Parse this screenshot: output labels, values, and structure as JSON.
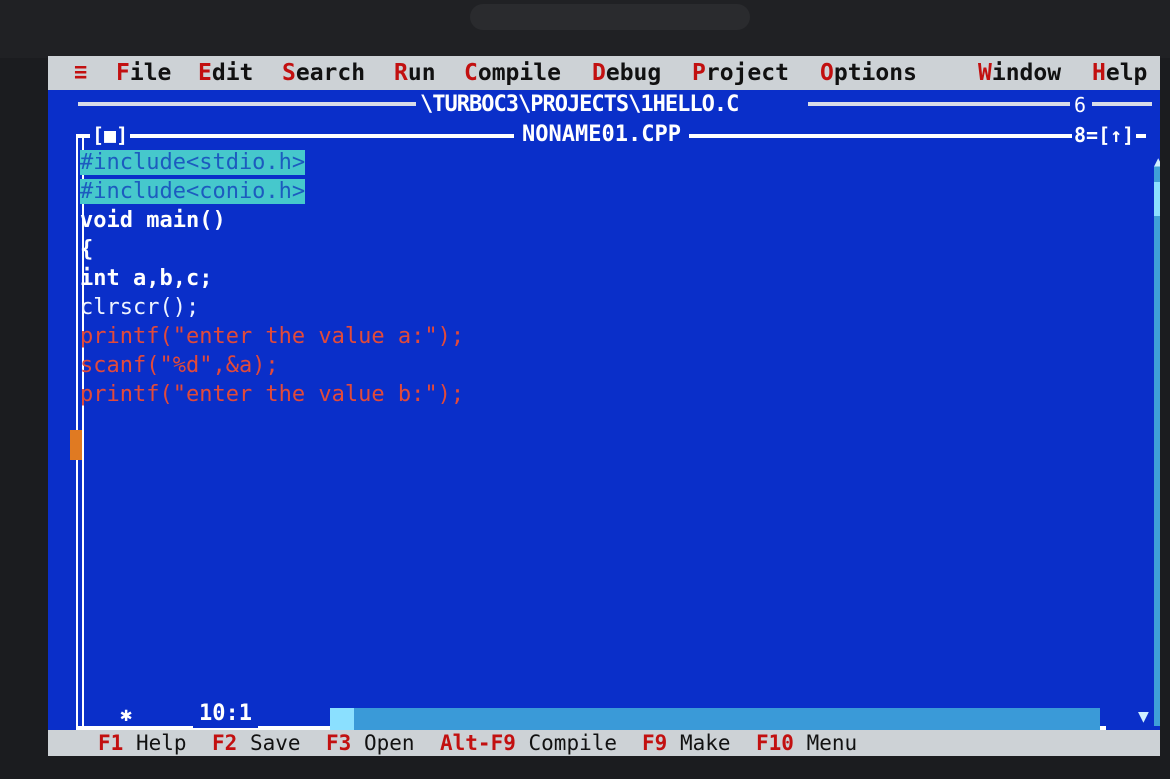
{
  "menubar": {
    "system_icon": "≡",
    "items": [
      {
        "hot": "F",
        "rest": "ile"
      },
      {
        "hot": "E",
        "rest": "dit"
      },
      {
        "hot": "S",
        "rest": "earch"
      },
      {
        "hot": "R",
        "rest": "un"
      },
      {
        "hot": "C",
        "rest": "ompile"
      },
      {
        "hot": "D",
        "rest": "ebug"
      },
      {
        "hot": "P",
        "rest": "roject"
      },
      {
        "hot": "O",
        "rest": "ptions"
      },
      {
        "hot": "W",
        "rest": "indow"
      },
      {
        "hot": "H",
        "rest": "elp"
      }
    ]
  },
  "back_window": {
    "title": "\\TURBOC3\\PROJECTS\\1HELLO.C",
    "number": "6"
  },
  "front_window": {
    "close_box": "[■]",
    "title": "NONAME01.CPP",
    "number_zoom": "8=[↑]"
  },
  "editor": {
    "lines": [
      "#include<stdio.h>",
      "#include<conio.h>",
      "void main()",
      "{",
      "int a,b,c;",
      "clrscr();",
      "printf(\"enter the value a:\");",
      "scanf(\"%d\",&a);",
      "printf(\"enter the value b:\");"
    ],
    "position": "10:1"
  },
  "statusbar": {
    "items": [
      {
        "key": "F1",
        "label": "Help"
      },
      {
        "key": "F2",
        "label": "Save"
      },
      {
        "key": "F3",
        "label": "Open"
      },
      {
        "key": "Alt-F9",
        "label": "Compile"
      },
      {
        "key": "F9",
        "label": "Make"
      },
      {
        "key": "F10",
        "label": "Menu"
      }
    ]
  },
  "colors": {
    "desktop_blue": "#0a2fc9",
    "menu_gray": "#cdd2d6",
    "hotkey_red": "#c21010",
    "selection_cyan": "#46c8cc"
  }
}
